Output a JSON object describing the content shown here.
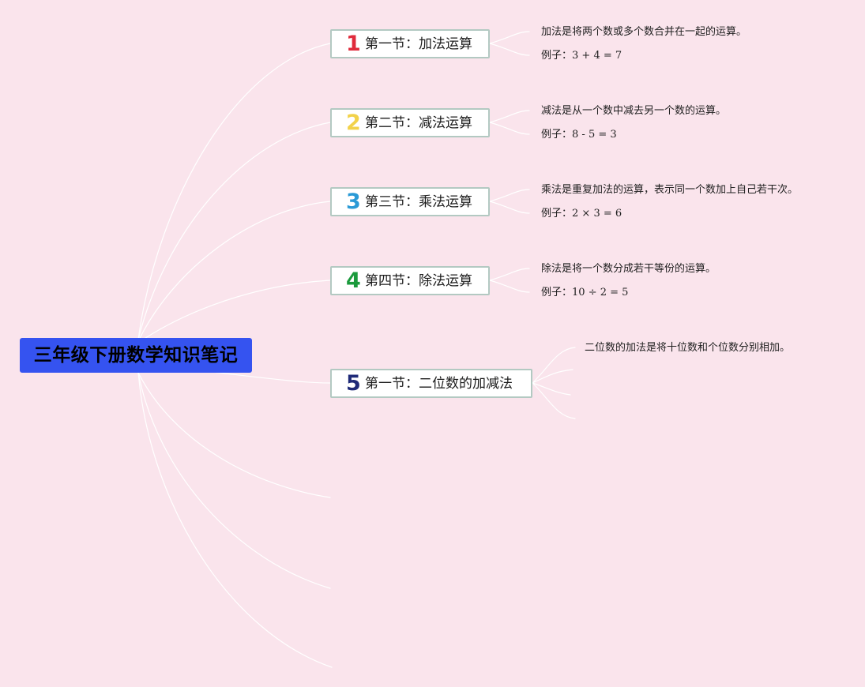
{
  "title": "三年级下册数学知识笔记",
  "colors": {
    "background": "#fae4ec",
    "root_fill": "#3553f0",
    "branch_border": "#b3c9c2",
    "connector": "#ffffff"
  },
  "sections": [
    {
      "number": "1",
      "badge_color": "#e02b3c",
      "label": "第一节：加法运算",
      "definition": "加法是将两个数或多个数合并在一起的运算。",
      "example_prefix": "例子：",
      "example": "3 + 4 = 7"
    },
    {
      "number": "2",
      "badge_color": "#f2d24a",
      "label": "第二节：减法运算",
      "definition": "减法是从一个数中减去另一个数的运算。",
      "example_prefix": "例子：",
      "example": "8 - 5 = 3"
    },
    {
      "number": "3",
      "badge_color": "#2a9ad6",
      "label": "第三节：乘法运算",
      "definition": "乘法是重复加法的运算，表示同一个数加上自己若干次。",
      "example_prefix": "例子：",
      "example": "2 × 3 = 6"
    },
    {
      "number": "4",
      "badge_color": "#1a9a3c",
      "label": "第四节：除法运算",
      "definition": "除法是将一个数分成若干等份的运算。",
      "example_prefix": "例子：",
      "example": "10 ÷ 2 = 5"
    },
    {
      "number": "5",
      "badge_color": "#1f2a78",
      "label": "第一节：二位数的加减法",
      "definition": "二位数的加法是将十位数和个位数分别相加。"
    }
  ]
}
